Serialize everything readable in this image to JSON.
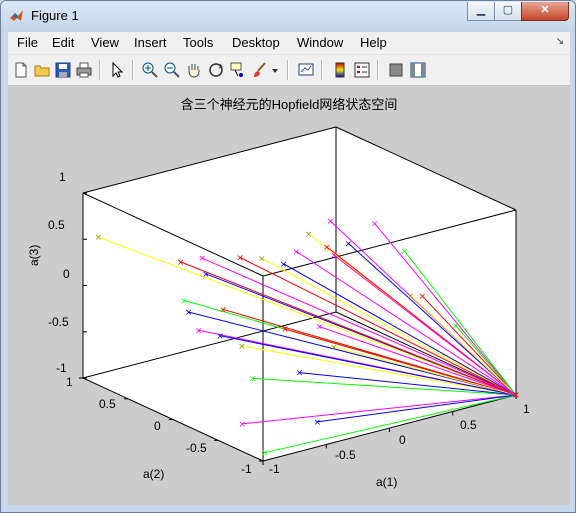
{
  "window": {
    "title": "Figure 1",
    "buttons": {
      "minimize": "▁",
      "maximize": "▢",
      "close": "✕"
    }
  },
  "menu": [
    "File",
    "Edit",
    "View",
    "Insert",
    "Tools",
    "Desktop",
    "Window",
    "Help"
  ],
  "toolbar_icons": [
    "new-figure-icon",
    "open-file-icon",
    "save-icon",
    "print-icon",
    "arrow-pointer-icon",
    "zoom-in-icon",
    "zoom-out-icon",
    "pan-hand-icon",
    "rotate-3d-icon",
    "data-cursor-icon",
    "brush-icon",
    "brush-menu-icon",
    "link-plot-icon",
    "insert-colorbar-icon",
    "insert-legend-icon",
    "hide-plot-tools-icon",
    "show-plot-tools-icon"
  ],
  "chart_data": {
    "type": "line",
    "projection": "3d",
    "title": "含三个神经元的Hopfield网络状态空间",
    "xlabel": "a(1)",
    "ylabel": "a(2)",
    "zlabel": "a(3)",
    "xlim": [
      -1,
      1
    ],
    "ylim": [
      -1,
      1
    ],
    "zlim": [
      -1,
      1
    ],
    "xticks": [
      "-1",
      "-0.5",
      "0",
      "0.5",
      "1"
    ],
    "yticks": [
      "-1",
      "-0.5",
      "0",
      "0.5",
      "1"
    ],
    "zticks": [
      "-1",
      "-0.5",
      "0",
      "0.5",
      "1"
    ],
    "grid": false,
    "equilibrium_point": [
      1,
      -1,
      -1
    ],
    "trajectories": [
      {
        "color": "#ffff00",
        "start": [
          -0.95,
          0.9,
          0.55
        ]
      },
      {
        "color": "#00ff00",
        "start": [
          -0.45,
          0.65,
          -0.2
        ]
      },
      {
        "color": "#0000ff",
        "start": [
          -0.2,
          0.95,
          -0.55
        ]
      },
      {
        "color": "#ff0000",
        "start": [
          -0.25,
          0.5,
          -0.3
        ]
      },
      {
        "color": "#ff00ff",
        "start": [
          -0.95,
          -0.7,
          -0.75
        ]
      },
      {
        "color": "#00ff00",
        "start": [
          -0.95,
          -0.95,
          -0.95
        ]
      },
      {
        "color": "#0000ff",
        "start": [
          -0.5,
          -0.9,
          -0.8
        ]
      },
      {
        "color": "#00ff00",
        "start": [
          -0.3,
          0.1,
          -0.85
        ]
      },
      {
        "color": "#0000ff",
        "start": [
          0.0,
          0.0,
          -0.85
        ]
      },
      {
        "color": "#ffff00",
        "start": [
          -0.1,
          0.5,
          -0.75
        ]
      },
      {
        "color": "#ff00ff",
        "start": [
          -0.3,
          0.7,
          -0.6
        ]
      },
      {
        "color": "#0000ff",
        "start": [
          -0.2,
          0.6,
          -0.65
        ]
      },
      {
        "color": "#ff0000",
        "start": [
          0.1,
          0.3,
          -0.55
        ]
      },
      {
        "color": "#ffff00",
        "start": [
          0.2,
          -0.1,
          -0.6
        ]
      },
      {
        "color": "#ff00ff",
        "start": [
          0.3,
          0.2,
          -0.55
        ]
      },
      {
        "color": "#0000ff",
        "start": [
          -0.1,
          0.9,
          -0.15
        ]
      },
      {
        "color": "#ff00ff",
        "start": [
          -0.2,
          0.8,
          0.1
        ]
      },
      {
        "color": "#ff0000",
        "start": [
          -0.3,
          0.9,
          0.05
        ]
      },
      {
        "color": "#ff0000",
        "start": [
          0.1,
          0.8,
          0.0
        ]
      },
      {
        "color": "#ffff00",
        "start": [
          0.2,
          0.7,
          0.0
        ]
      },
      {
        "color": "#0000ff",
        "start": [
          0.3,
          0.6,
          -0.05
        ]
      },
      {
        "color": "#ff00ff",
        "start": [
          0.4,
          0.6,
          0.05
        ]
      },
      {
        "color": "#ffff00",
        "start": [
          0.5,
          0.6,
          0.2
        ]
      },
      {
        "color": "#ff00ff",
        "start": [
          0.6,
          0.5,
          0.35
        ]
      },
      {
        "color": "#ff0000",
        "start": [
          0.5,
          0.4,
          0.15
        ]
      },
      {
        "color": "#0000ff",
        "start": [
          0.6,
          0.3,
          0.2
        ]
      },
      {
        "color": "#00ff00",
        "start": [
          0.9,
          0.1,
          0.1
        ]
      },
      {
        "color": "#ff0000",
        "start": [
          0.9,
          -0.1,
          -0.3
        ]
      },
      {
        "color": "#ffff00",
        "start": [
          0.95,
          0.1,
          -0.4
        ]
      },
      {
        "color": "#ff00ff",
        "start": [
          0.95,
          0.5,
          0.2
        ]
      },
      {
        "color": "#00ff00",
        "start": [
          0.95,
          -0.4,
          -0.5
        ]
      },
      {
        "color": "#ff00ff",
        "start": [
          0.7,
          0.6,
          -0.1
        ]
      }
    ]
  }
}
